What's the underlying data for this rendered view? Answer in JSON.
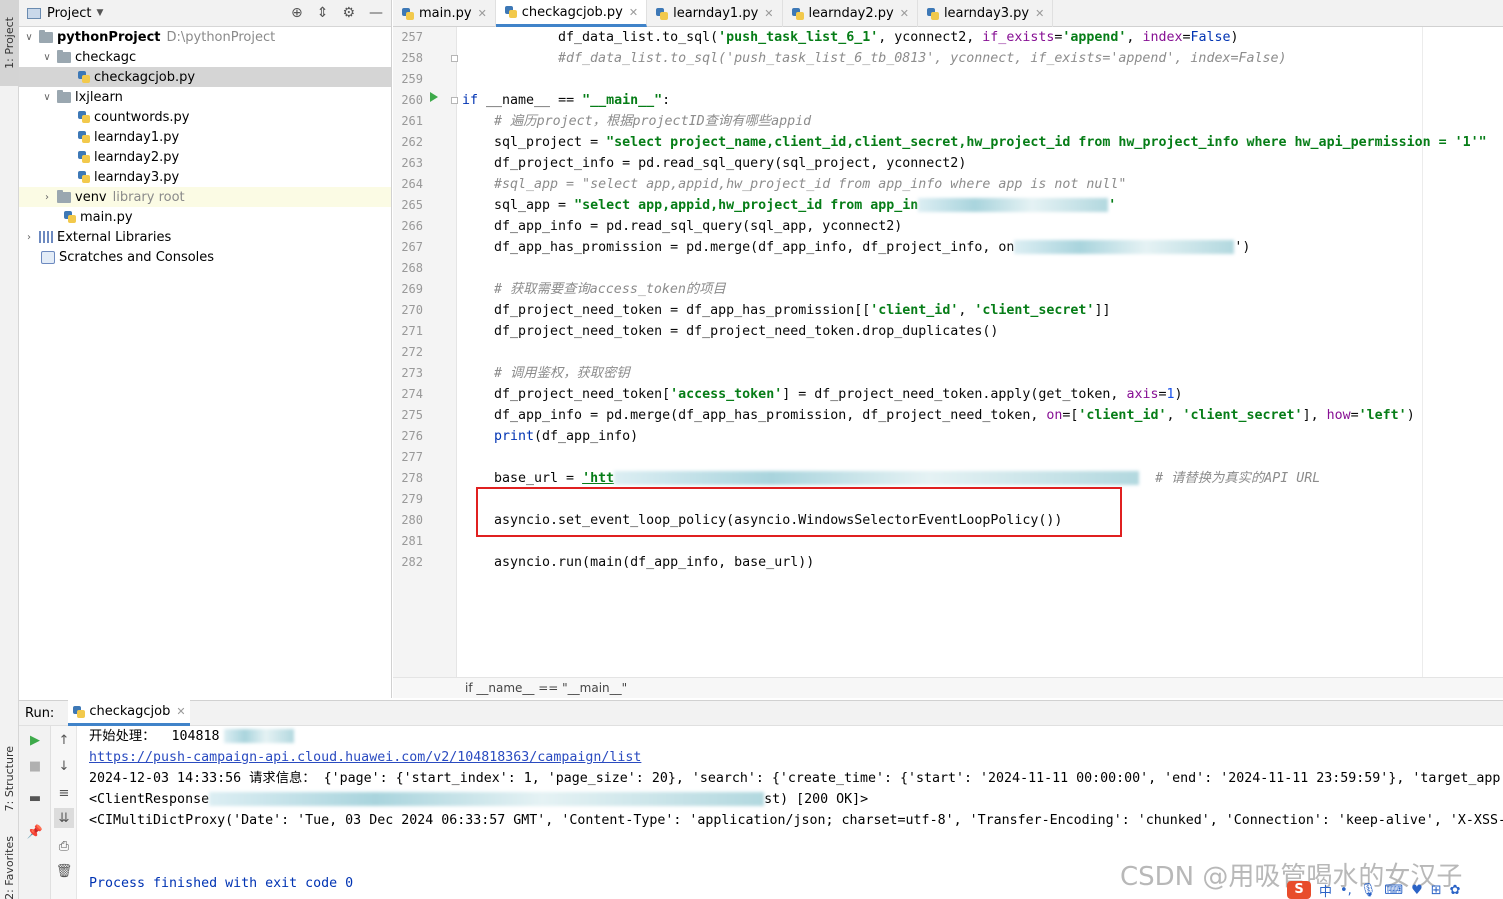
{
  "left_strip": {
    "project_tab": "1: Project",
    "structure_tab": "7: Structure",
    "favorites_tab": "2: Favorites"
  },
  "project_panel": {
    "title": "Project",
    "tree": [
      {
        "label": "pythonProject",
        "path": "D:\\pythonProject",
        "kind": "folder",
        "open": true
      },
      {
        "label": "checkagc",
        "kind": "folder",
        "open": true
      },
      {
        "label": "checkagcjob.py",
        "kind": "py",
        "selected": true
      },
      {
        "label": "lxjlearn",
        "kind": "folder",
        "open": true
      },
      {
        "label": "countwords.py",
        "kind": "py"
      },
      {
        "label": "learnday1.py",
        "kind": "py"
      },
      {
        "label": "learnday2.py",
        "kind": "py"
      },
      {
        "label": "learnday3.py",
        "kind": "py"
      },
      {
        "label": "venv",
        "extra": "library root",
        "kind": "folder"
      },
      {
        "label": "main.py",
        "kind": "py"
      },
      {
        "label": "External Libraries",
        "kind": "lib"
      },
      {
        "label": "Scratches and Consoles",
        "kind": "scratch"
      }
    ]
  },
  "tabs": [
    "main.py",
    "checkagcjob.py",
    "learnday1.py",
    "learnday2.py",
    "learnday3.py"
  ],
  "active_tab": "checkagcjob.py",
  "editor": {
    "line_numbers": [
      "257",
      "258",
      "259",
      "260",
      "261",
      "262",
      "263",
      "264",
      "265",
      "266",
      "267",
      "268",
      "269",
      "270",
      "271",
      "272",
      "273",
      "274",
      "275",
      "276",
      "277",
      "278",
      "279",
      "280",
      "281",
      "282"
    ],
    "lines": [
      "df_data_list.to_sql('push_task_list_6_1', yconnect2, if_exists='append', index=False)",
      "#df_data_list.to_sql('push_task_list_6_tb_0813', yconnect, if_exists='append', index=False)",
      "",
      "if __name__ == \"__main__\":",
      "# 遍历project，根据projectID查询有哪些appid",
      "sql_project = \"select project_name,client_id,client_secret,hw_project_id from hw_project_info where hw_api_permission = '1'\"",
      "df_project_info = pd.read_sql_query(sql_project, yconnect2)",
      "#sql_app = \"select app,appid,hw_project_id from app_info where app is not null\"",
      "sql_app = \"select app,appid,hw_project_id from app_in",
      "df_app_info = pd.read_sql_query(sql_app, yconnect2)",
      "df_app_has_promission = pd.merge(df_app_info, df_project_info, on",
      "",
      "# 获取需要查询access_token的项目",
      "df_project_need_token = df_app_has_promission[['client_id', 'client_secret']]",
      "df_project_need_token = df_project_need_token.drop_duplicates()",
      "",
      "# 调用鉴权，获取密钥",
      "df_project_need_token['access_token'] = df_project_need_token.apply(get_token, axis=1)",
      "df_app_info = pd.merge(df_app_has_promission, df_project_need_token, on=['client_id', 'client_secret'], how='left')",
      "print(df_app_info)",
      "",
      "base_url = 'htt",
      "",
      "asyncio.set_event_loop_policy(asyncio.WindowsSelectorEventLoopPolicy())",
      "",
      "asyncio.run(main(df_app_info, base_url))"
    ],
    "url_comment": "# 请替换为真实的API URL",
    "breadcrumb": "if __name__ == \"__main__\""
  },
  "run_panel": {
    "label": "Run:",
    "tab": "checkagcjob",
    "output": [
      "开始处理：  104818",
      "https://push-campaign-api.cloud.huawei.com/v2/104818363/campaign/list",
      "2024-12-03 14:33:56 请求信息： {'page': {'start_index': 1, 'page_size': 20}, 'search': {'create_time': {'start': '2024-11-11 00:00:00', 'end': '2024-11-11 23:59:59'}, 'target_app",
      "<ClientResponse",
      "<CIMultiDictProxy('Date': 'Tue, 03 Dec 2024 06:33:57 GMT', 'Content-Type': 'application/json; charset=utf-8', 'Transfer-Encoding': 'chunked', 'Connection': 'keep-alive', 'X-XSS-",
      "",
      "Process finished with exit code 0"
    ],
    "response_tail": "st) [200 OK]>"
  },
  "watermark": "CSDN @用吸管喝水的女汉子",
  "ime": {
    "badge": "S",
    "lang": "中"
  },
  "colors": {
    "accent": "#4083c9",
    "highlight_box": "#e02020",
    "keyword": "#0033b3",
    "string": "#067d17"
  }
}
